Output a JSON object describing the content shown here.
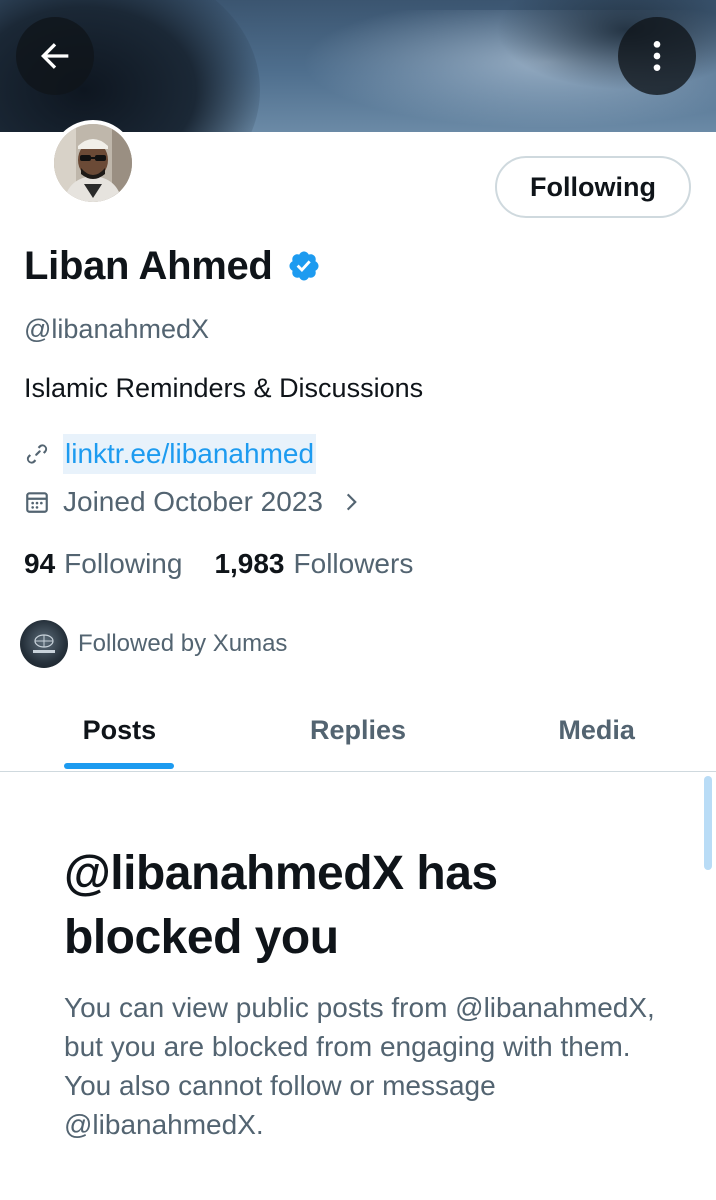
{
  "colors": {
    "accent": "#1d9bf0",
    "text_primary": "#0f1419",
    "text_secondary": "#536471",
    "border": "#cfd9de",
    "verified": "#1d9bf0"
  },
  "header": {
    "back_icon": "arrow-left-icon",
    "more_icon": "more-vertical-icon"
  },
  "profile": {
    "name": "Liban Ahmed",
    "verified": true,
    "handle": "@libanahmedX",
    "bio": "Islamic Reminders & Discussions",
    "link": "linktr.ee/libanahmed",
    "joined": "Joined October 2023",
    "following_count": "94",
    "following_label": "Following",
    "followers_count": "1,983",
    "followers_label": "Followers",
    "followed_by": "Followed by Xumas",
    "follow_button_label": "Following"
  },
  "tabs": [
    {
      "label": "Posts",
      "active": true
    },
    {
      "label": "Replies",
      "active": false
    },
    {
      "label": "Media",
      "active": false
    }
  ],
  "blocked": {
    "title": "@libanahmedX has blocked you",
    "body": "You can view public posts from @libanahmedX, but you are blocked from engaging with them. You also cannot follow or message @libanahmedX."
  }
}
